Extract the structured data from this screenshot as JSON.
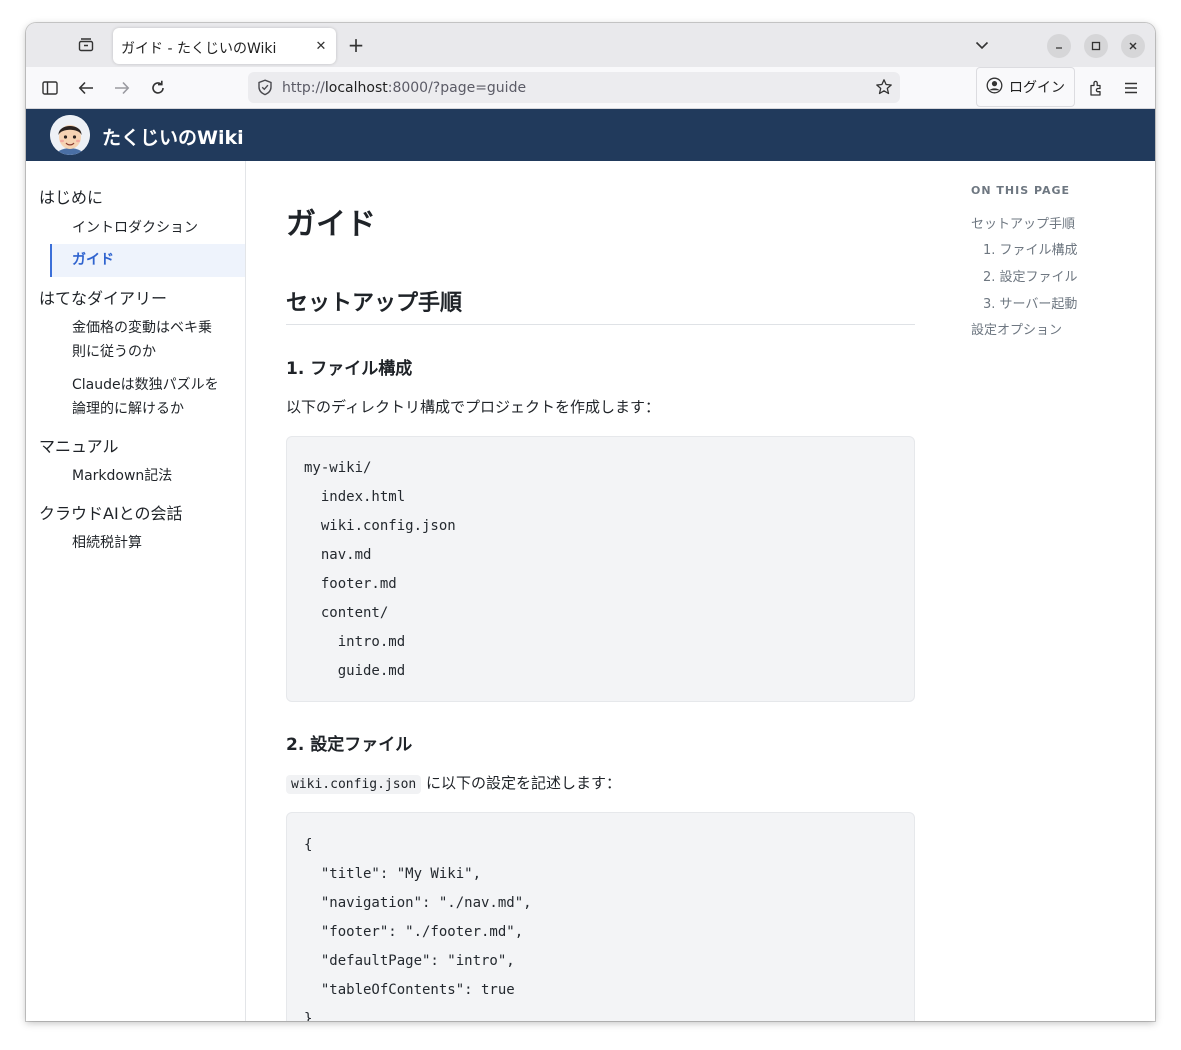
{
  "browser": {
    "tab_title": "ガイド - たくじいのWiki",
    "tab_close": "✕",
    "new_tab": "+",
    "url_scheme": "http://",
    "url_host": "localhost",
    "url_rest": ":8000/?page=guide",
    "login_label": "ログイン"
  },
  "site": {
    "title": "たくじいのWiki"
  },
  "sidebar": {
    "sections": [
      {
        "label": "はじめに",
        "items": [
          "イントロダクション",
          "ガイド"
        ]
      },
      {
        "label": "はてなダイアリー",
        "items": [
          "金価格の変動はベキ乗\n則に従うのか",
          "Claudeは数独パズルを\n論理的に解けるか"
        ]
      },
      {
        "label": "マニュアル",
        "items": [
          "Markdown記法"
        ]
      },
      {
        "label": "クラウドAIとの会話",
        "items": [
          "相続税計算"
        ]
      }
    ],
    "active": "ガイド"
  },
  "content": {
    "h1": "ガイド",
    "h2": "セットアップ手順",
    "sec1_title": "1. ファイル構成",
    "sec1_text": "以下のディレクトリ構成でプロジェクトを作成します：",
    "tree_lines": [
      "my-wiki/",
      "  index.html",
      "  wiki.config.json",
      "  nav.md",
      "  footer.md",
      "  content/",
      "    intro.md",
      "    guide.md"
    ],
    "sec2_title": "2. 設定ファイル",
    "sec2_code": "wiki.config.json",
    "sec2_text": " に以下の設定を記述します：",
    "config_lines": [
      "{",
      "  \"title\": \"My Wiki\",",
      "  \"navigation\": \"./nav.md\",",
      "  \"footer\": \"./footer.md\",",
      "  \"defaultPage\": \"intro\",",
      "  \"tableOfContents\": true",
      "}"
    ]
  },
  "toc": {
    "heading": "ON THIS PAGE",
    "items": [
      "セットアップ手順",
      "1. ファイル構成",
      "2. 設定ファイル",
      "3. サーバー起動",
      "設定オプション"
    ]
  }
}
